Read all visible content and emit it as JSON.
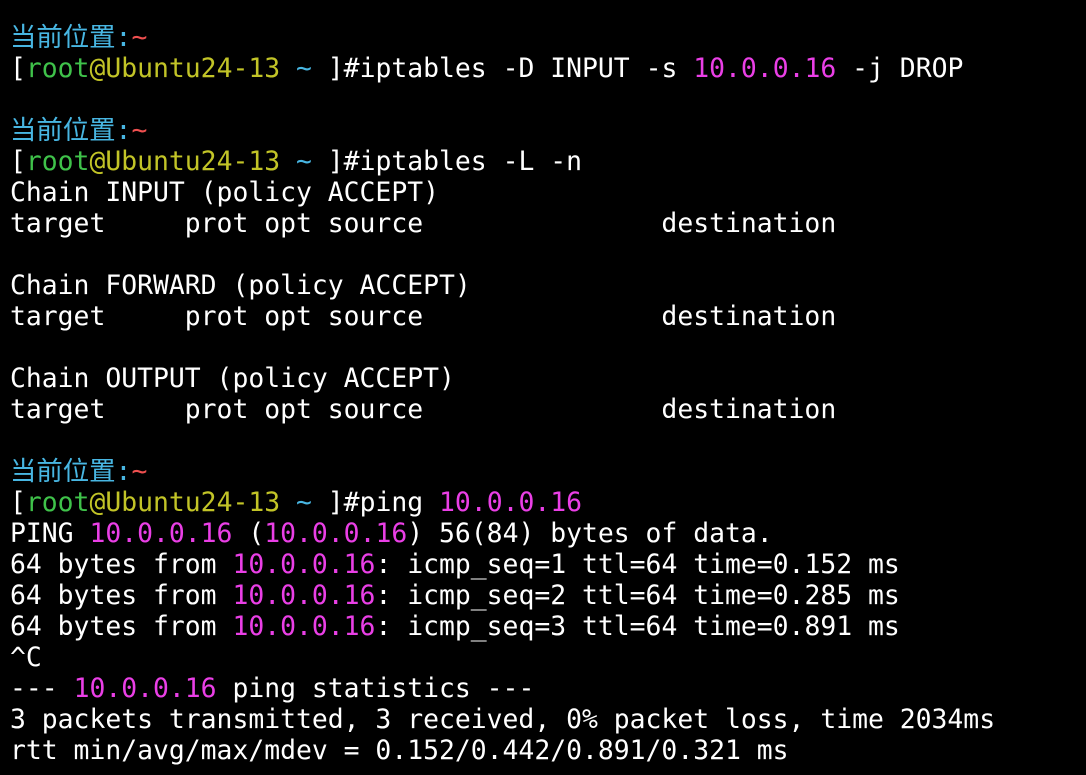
{
  "colors": {
    "background": "#000000",
    "text": "#ffffff",
    "location_label": "#48b6e2",
    "tilde": "#ef4f4f",
    "user": "#3fc24a",
    "host": "#c2c427",
    "ip_address": "#ea3fe6"
  },
  "prompt": {
    "location_label": "当前位置:",
    "path": "~",
    "open_bracket": "[",
    "user": "root",
    "at": "@",
    "host": "Ubuntu24-13",
    "cwd": " ~ ",
    "close_bracket": "]#"
  },
  "lines": [
    {
      "kind": "location",
      "segs": [
        {
          "t": "当前位置:",
          "c": "c-cyan"
        },
        {
          "t": "~",
          "c": "c-red"
        }
      ]
    },
    {
      "kind": "command",
      "segs": [
        {
          "t": "[",
          "c": "c-white"
        },
        {
          "t": "root",
          "c": "c-green"
        },
        {
          "t": "@",
          "c": "c-yellow"
        },
        {
          "t": "Ubuntu24-13",
          "c": "c-yellow"
        },
        {
          "t": " ~ ",
          "c": "c-cyan"
        },
        {
          "t": "]#",
          "c": "c-white"
        },
        {
          "t": "iptables -D INPUT -s ",
          "c": "c-white"
        },
        {
          "t": "10.0.0.16",
          "c": "c-magenta"
        },
        {
          "t": " -j DROP",
          "c": "c-white"
        }
      ]
    },
    {
      "kind": "blank",
      "segs": []
    },
    {
      "kind": "location",
      "segs": [
        {
          "t": "当前位置:",
          "c": "c-cyan"
        },
        {
          "t": "~",
          "c": "c-red"
        }
      ]
    },
    {
      "kind": "command",
      "segs": [
        {
          "t": "[",
          "c": "c-white"
        },
        {
          "t": "root",
          "c": "c-green"
        },
        {
          "t": "@",
          "c": "c-yellow"
        },
        {
          "t": "Ubuntu24-13",
          "c": "c-yellow"
        },
        {
          "t": " ~ ",
          "c": "c-cyan"
        },
        {
          "t": "]#",
          "c": "c-white"
        },
        {
          "t": "iptables -L -n",
          "c": "c-white"
        }
      ]
    },
    {
      "kind": "output",
      "segs": [
        {
          "t": "Chain INPUT (policy ACCEPT)",
          "c": "c-white"
        }
      ]
    },
    {
      "kind": "output",
      "segs": [
        {
          "t": "target     prot opt source               destination",
          "c": "c-white"
        }
      ]
    },
    {
      "kind": "blank",
      "segs": []
    },
    {
      "kind": "output",
      "segs": [
        {
          "t": "Chain FORWARD (policy ACCEPT)",
          "c": "c-white"
        }
      ]
    },
    {
      "kind": "output",
      "segs": [
        {
          "t": "target     prot opt source               destination",
          "c": "c-white"
        }
      ]
    },
    {
      "kind": "blank",
      "segs": []
    },
    {
      "kind": "output",
      "segs": [
        {
          "t": "Chain OUTPUT (policy ACCEPT)",
          "c": "c-white"
        }
      ]
    },
    {
      "kind": "output",
      "segs": [
        {
          "t": "target     prot opt source               destination",
          "c": "c-white"
        }
      ]
    },
    {
      "kind": "blank",
      "segs": []
    },
    {
      "kind": "location",
      "segs": [
        {
          "t": "当前位置:",
          "c": "c-cyan"
        },
        {
          "t": "~",
          "c": "c-red"
        }
      ]
    },
    {
      "kind": "command",
      "segs": [
        {
          "t": "[",
          "c": "c-white"
        },
        {
          "t": "root",
          "c": "c-green"
        },
        {
          "t": "@",
          "c": "c-yellow"
        },
        {
          "t": "Ubuntu24-13",
          "c": "c-yellow"
        },
        {
          "t": " ~ ",
          "c": "c-cyan"
        },
        {
          "t": "]#",
          "c": "c-white"
        },
        {
          "t": "ping ",
          "c": "c-white"
        },
        {
          "t": "10.0.0.16",
          "c": "c-magenta"
        }
      ]
    },
    {
      "kind": "output",
      "segs": [
        {
          "t": "PING ",
          "c": "c-white"
        },
        {
          "t": "10.0.0.16",
          "c": "c-magenta"
        },
        {
          "t": " (",
          "c": "c-white"
        },
        {
          "t": "10.0.0.16",
          "c": "c-magenta"
        },
        {
          "t": ") 56(84) bytes of data.",
          "c": "c-white"
        }
      ]
    },
    {
      "kind": "output",
      "segs": [
        {
          "t": "64 bytes from ",
          "c": "c-white"
        },
        {
          "t": "10.0.0.16",
          "c": "c-magenta"
        },
        {
          "t": ": icmp_seq=1 ttl=64 time=0.152 ms",
          "c": "c-white"
        }
      ]
    },
    {
      "kind": "output",
      "segs": [
        {
          "t": "64 bytes from ",
          "c": "c-white"
        },
        {
          "t": "10.0.0.16",
          "c": "c-magenta"
        },
        {
          "t": ": icmp_seq=2 ttl=64 time=0.285 ms",
          "c": "c-white"
        }
      ]
    },
    {
      "kind": "output",
      "segs": [
        {
          "t": "64 bytes from ",
          "c": "c-white"
        },
        {
          "t": "10.0.0.16",
          "c": "c-magenta"
        },
        {
          "t": ": icmp_seq=3 ttl=64 time=0.891 ms",
          "c": "c-white"
        }
      ]
    },
    {
      "kind": "output",
      "segs": [
        {
          "t": "^C",
          "c": "c-white"
        }
      ]
    },
    {
      "kind": "output",
      "segs": [
        {
          "t": "--- ",
          "c": "c-white"
        },
        {
          "t": "10.0.0.16",
          "c": "c-magenta"
        },
        {
          "t": " ping statistics ---",
          "c": "c-white"
        }
      ]
    },
    {
      "kind": "output",
      "segs": [
        {
          "t": "3 packets transmitted, 3 received, 0% packet loss, time 2034ms",
          "c": "c-white"
        }
      ]
    },
    {
      "kind": "output",
      "segs": [
        {
          "t": "rtt min/avg/max/mdev = 0.152/0.442/0.891/0.321 ms",
          "c": "c-white"
        }
      ]
    }
  ]
}
